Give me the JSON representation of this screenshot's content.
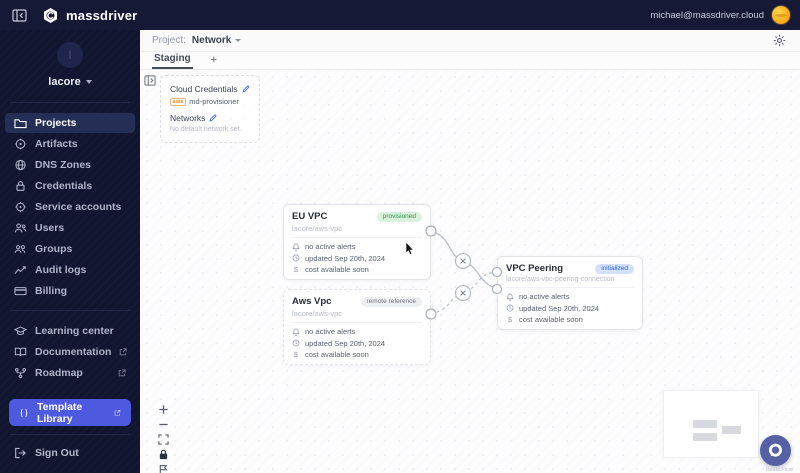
{
  "topbar": {
    "brand": "massdriver",
    "user_email": "michael@massdriver.cloud"
  },
  "sidebar": {
    "org": {
      "name": "lacore",
      "avatar_letter": "l"
    },
    "items": [
      {
        "label": "Projects",
        "active": true
      },
      {
        "label": "Artifacts"
      },
      {
        "label": "DNS Zones"
      },
      {
        "label": "Credentials"
      },
      {
        "label": "Service accounts"
      },
      {
        "label": "Users"
      },
      {
        "label": "Groups"
      },
      {
        "label": "Audit logs"
      },
      {
        "label": "Billing"
      }
    ],
    "secondary": [
      {
        "label": "Learning center"
      },
      {
        "label": "Documentation",
        "external": true
      },
      {
        "label": "Roadmap",
        "external": true
      }
    ],
    "template_library": "Template Library",
    "sign_out": "Sign Out"
  },
  "header": {
    "project_label": "Project:",
    "project_name": "Network"
  },
  "tabs": {
    "active_tab": "Staging",
    "add_label": "+"
  },
  "context_panel": {
    "cloud_credentials_label": "Cloud Credentials",
    "provider": "aws",
    "credential_name": "md-provisioner",
    "networks_label": "Networks",
    "networks_empty": "No default network set."
  },
  "nodes": [
    {
      "title": "EU VPC",
      "badge": "provisioned",
      "badge_type": "provisioned",
      "subtitle": "lacore/aws-vpc",
      "alerts": "no active alerts",
      "updated": "updated Sep 20th, 2024",
      "cost": "cost available soon",
      "cost_icon": "$"
    },
    {
      "title": "Aws Vpc",
      "badge": "remote reference",
      "badge_type": "remote",
      "subtitle": "lacore/aws-vpc",
      "alerts": "no active alerts",
      "updated": "updated Sep 20th, 2024",
      "cost": "cost available soon",
      "cost_icon": "$"
    },
    {
      "title": "VPC Peering",
      "badge": "initialized",
      "badge_type": "initialized",
      "subtitle": "lacore/aws-vpc-peering-connection",
      "alerts": "no active alerts",
      "updated": "updated Sep 20th, 2024",
      "cost": "cost available soon",
      "cost_icon": "$"
    }
  ],
  "attribution": "React Flow",
  "colors": {
    "topbar_bg": "#151936",
    "sidebar_bg": "#111530",
    "accent_button": "#4d59df",
    "active_item_bg": "#252e55",
    "provisioned_badge": "#d9f2de",
    "initialized_badge": "#d3e1fd",
    "remote_badge": "#eeeff1",
    "avatar": "#f5a913",
    "chat_widget": "#5560a5"
  }
}
